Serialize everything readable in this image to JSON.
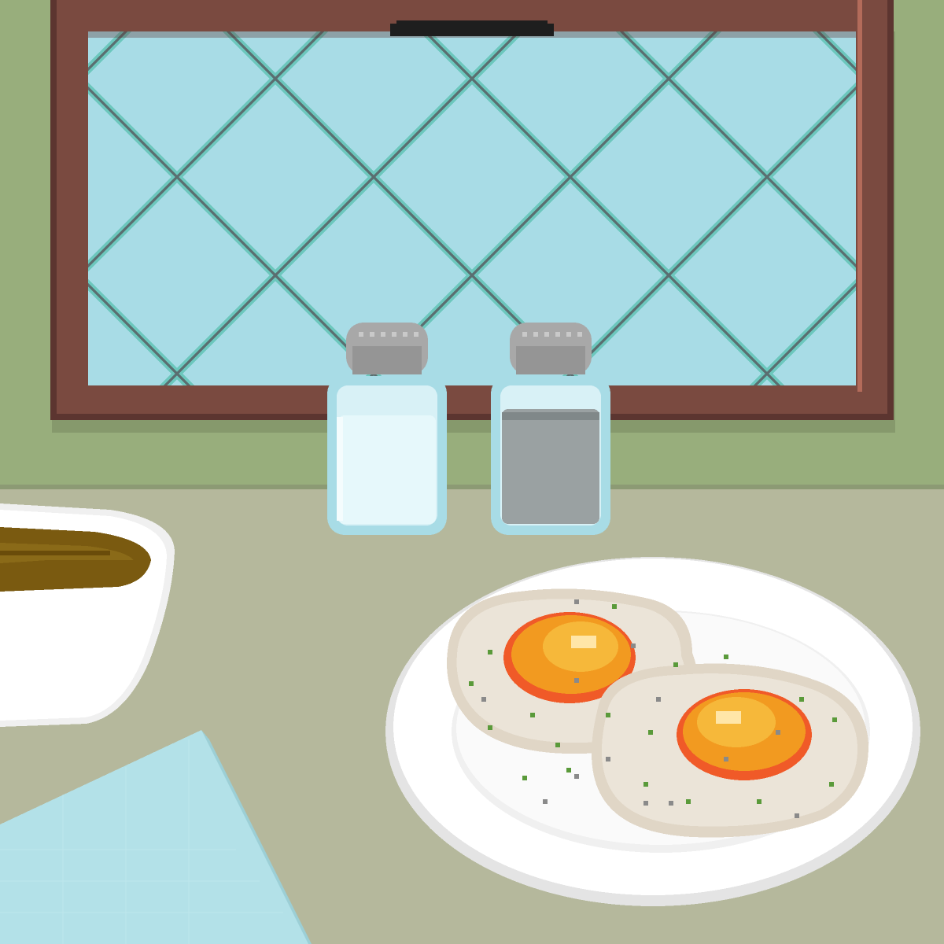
{
  "scene": {
    "wall_color": "#98ae7c",
    "table_color": "#b5b89c",
    "window_frame_color": "#7a4a40",
    "window_glass_color": "#a8dce6",
    "window_lattice_color": "#6cc7bd",
    "shaker_cap_color": "#a8a8a8",
    "salt_color": "#e6f8fb",
    "pepper_color": "#9aa1a2",
    "bowl_color": "#ffffff",
    "soup_color": "#7a5a10",
    "plate_color": "#ffffff",
    "egg_white_color": "#e8e0d2",
    "yolk_color": "#f2a020",
    "napkin_color": "#b3e1e8"
  }
}
